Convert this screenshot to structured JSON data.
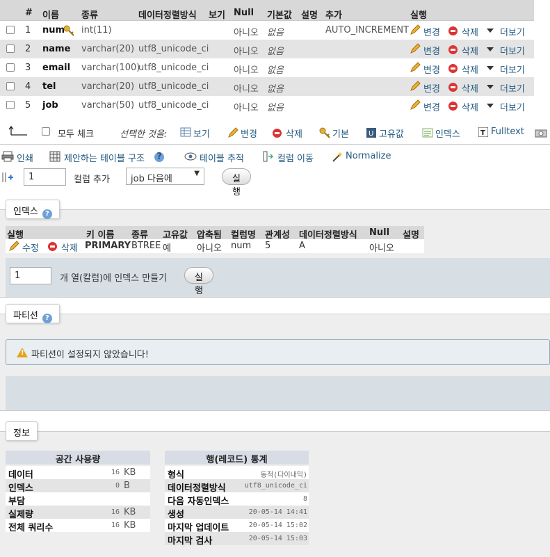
{
  "structure": {
    "headers": [
      "#",
      "이름",
      "종류",
      "데이터정렬방식",
      "보기",
      "Null",
      "기본값",
      "설명",
      "추가",
      "실행"
    ],
    "rows": [
      {
        "num": "1",
        "name": "num",
        "type": "int(11)",
        "collation": "",
        "null": "아니오",
        "default": "없음",
        "extra": "AUTO_INCREMENT"
      },
      {
        "num": "2",
        "name": "name",
        "type": "varchar(20)",
        "collation": "utf8_unicode_ci",
        "null": "아니오",
        "default": "없음",
        "extra": ""
      },
      {
        "num": "3",
        "name": "email",
        "type": "varchar(100)",
        "collation": "utf8_unicode_ci",
        "null": "아니오",
        "default": "없음",
        "extra": ""
      },
      {
        "num": "4",
        "name": "tel",
        "type": "varchar(20)",
        "collation": "utf8_unicode_ci",
        "null": "아니오",
        "default": "없음",
        "extra": ""
      },
      {
        "num": "5",
        "name": "job",
        "type": "varchar(50)",
        "collation": "utf8_unicode_ci",
        "null": "아니오",
        "default": "없음",
        "extra": ""
      }
    ],
    "actions": {
      "change": "변경",
      "delete": "삭제",
      "more": "더보기"
    }
  },
  "bulk": {
    "check_all": "모두 체크",
    "with_selected": "선택한 것을:",
    "browse": "보기",
    "change": "변경",
    "delete": "삭제",
    "primary": "기본",
    "unique": "고유값",
    "index": "인덱스",
    "fulltext": "Fulltext"
  },
  "toolbar": {
    "print": "인쇄",
    "propose": "제안하는 테이블 구조",
    "track": "테이블 추적",
    "move": "컬럼 이동",
    "normalize": "Normalize"
  },
  "add_column": {
    "count": "1",
    "label": "컬럼 추가",
    "position": "job 다음에",
    "go": "실행"
  },
  "indexes": {
    "legend": "인덱스",
    "headers": [
      "실행",
      "키 이름",
      "종류",
      "고유값",
      "압축됨",
      "컬럼명",
      "관계성",
      "데이터정렬방식",
      "Null",
      "설명"
    ],
    "row": {
      "edit": "수정",
      "delete": "삭제",
      "keyname": "PRIMARY",
      "type": "BTREE",
      "unique": "예",
      "packed": "아니오",
      "column": "num",
      "cardinality": "5",
      "collation": "A",
      "null": "아니오",
      "comment": ""
    },
    "create_count": "1",
    "create_label": "개 열(칼럼)에 인덱스 만들기",
    "go": "실행"
  },
  "partitions": {
    "legend": "파티션",
    "notice": "파티션이 설정되지 않았습니다!"
  },
  "info": {
    "legend": "정보",
    "space": {
      "title": "공간 사용량",
      "rows": [
        {
          "label": "데이터",
          "value": "16",
          "unit": "KB"
        },
        {
          "label": "인덱스",
          "value": "0",
          "unit": "B"
        },
        {
          "label": "부담",
          "value": "",
          "unit": ""
        },
        {
          "label": "실제량",
          "value": "16",
          "unit": "KB"
        },
        {
          "label": "전체 쿼리수",
          "value": "16",
          "unit": "KB"
        }
      ]
    },
    "stats": {
      "title": "행(레코드) 통계",
      "rows": [
        {
          "label": "형식",
          "value": "동적(다이내믹)"
        },
        {
          "label": "데이터정렬방식",
          "value": "utf8_unicode_ci"
        },
        {
          "label": "다음 자동인덱스",
          "value": "8"
        },
        {
          "label": "생성",
          "value": "20-05-14 14:41"
        },
        {
          "label": "마지막 업데이트",
          "value": "20-05-14 15:02"
        },
        {
          "label": "마지막 검사",
          "value": "20-05-14 15:03"
        }
      ]
    }
  }
}
